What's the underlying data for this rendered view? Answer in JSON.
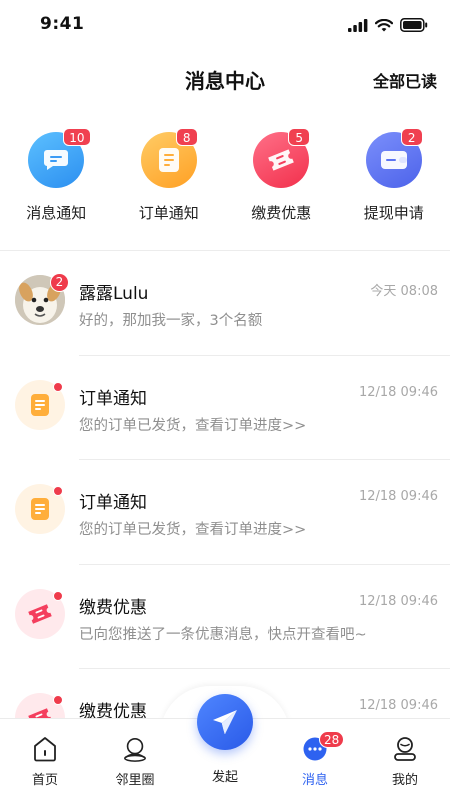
{
  "status_bar": {
    "time": "9:41"
  },
  "header": {
    "title": "消息中心",
    "action": "全部已读"
  },
  "categories": [
    {
      "label": "消息通知",
      "badge": "10",
      "icon": "chat-bubble-icon",
      "color": "#3a9bf5"
    },
    {
      "label": "订单通知",
      "badge": "8",
      "icon": "document-icon",
      "color": "#ffae3b"
    },
    {
      "label": "缴费优惠",
      "badge": "5",
      "icon": "coupon-icon",
      "color": "#f43f5e"
    },
    {
      "label": "提现申请",
      "badge": "2",
      "icon": "wallet-icon",
      "color": "#5b73f2"
    }
  ],
  "messages": [
    {
      "title": "露露Lulu",
      "time": "今天  08:08",
      "subtitle": "好的，那加我一家，3个名额",
      "badge": "2",
      "icon": "dog-avatar"
    },
    {
      "title": "订单通知",
      "time": "12/18 09:46",
      "subtitle": "您的订单已发货，查看订单进度>>",
      "icon": "document-icon"
    },
    {
      "title": "订单通知",
      "time": "12/18 09:46",
      "subtitle": "您的订单已发货，查看订单进度>>",
      "icon": "document-icon"
    },
    {
      "title": "缴费优惠",
      "time": "12/18 09:46",
      "subtitle": "已向您推送了一条优惠消息，快点开查看吧~",
      "icon": "coupon-icon"
    },
    {
      "title": "缴费优惠",
      "time": "12/18 09:46",
      "subtitle": "",
      "icon": "coupon-icon"
    }
  ],
  "tabbar": {
    "home": "首页",
    "neighbors": "邻里圈",
    "post": "发起",
    "messages": "消息",
    "messages_badge": "28",
    "profile": "我的",
    "active_color": "#2e62f0"
  }
}
